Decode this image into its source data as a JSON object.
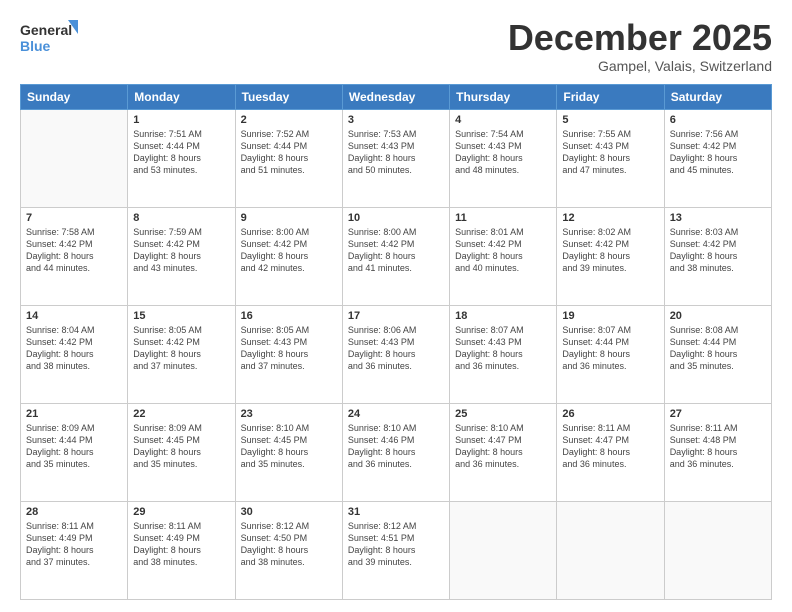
{
  "header": {
    "logo_line1": "General",
    "logo_line2": "Blue",
    "month": "December 2025",
    "location": "Gampel, Valais, Switzerland"
  },
  "weekdays": [
    "Sunday",
    "Monday",
    "Tuesday",
    "Wednesday",
    "Thursday",
    "Friday",
    "Saturday"
  ],
  "weeks": [
    [
      {
        "day": "",
        "detail": ""
      },
      {
        "day": "1",
        "detail": "Sunrise: 7:51 AM\nSunset: 4:44 PM\nDaylight: 8 hours\nand 53 minutes."
      },
      {
        "day": "2",
        "detail": "Sunrise: 7:52 AM\nSunset: 4:44 PM\nDaylight: 8 hours\nand 51 minutes."
      },
      {
        "day": "3",
        "detail": "Sunrise: 7:53 AM\nSunset: 4:43 PM\nDaylight: 8 hours\nand 50 minutes."
      },
      {
        "day": "4",
        "detail": "Sunrise: 7:54 AM\nSunset: 4:43 PM\nDaylight: 8 hours\nand 48 minutes."
      },
      {
        "day": "5",
        "detail": "Sunrise: 7:55 AM\nSunset: 4:43 PM\nDaylight: 8 hours\nand 47 minutes."
      },
      {
        "day": "6",
        "detail": "Sunrise: 7:56 AM\nSunset: 4:42 PM\nDaylight: 8 hours\nand 45 minutes."
      }
    ],
    [
      {
        "day": "7",
        "detail": "Sunrise: 7:58 AM\nSunset: 4:42 PM\nDaylight: 8 hours\nand 44 minutes."
      },
      {
        "day": "8",
        "detail": "Sunrise: 7:59 AM\nSunset: 4:42 PM\nDaylight: 8 hours\nand 43 minutes."
      },
      {
        "day": "9",
        "detail": "Sunrise: 8:00 AM\nSunset: 4:42 PM\nDaylight: 8 hours\nand 42 minutes."
      },
      {
        "day": "10",
        "detail": "Sunrise: 8:00 AM\nSunset: 4:42 PM\nDaylight: 8 hours\nand 41 minutes."
      },
      {
        "day": "11",
        "detail": "Sunrise: 8:01 AM\nSunset: 4:42 PM\nDaylight: 8 hours\nand 40 minutes."
      },
      {
        "day": "12",
        "detail": "Sunrise: 8:02 AM\nSunset: 4:42 PM\nDaylight: 8 hours\nand 39 minutes."
      },
      {
        "day": "13",
        "detail": "Sunrise: 8:03 AM\nSunset: 4:42 PM\nDaylight: 8 hours\nand 38 minutes."
      }
    ],
    [
      {
        "day": "14",
        "detail": "Sunrise: 8:04 AM\nSunset: 4:42 PM\nDaylight: 8 hours\nand 38 minutes."
      },
      {
        "day": "15",
        "detail": "Sunrise: 8:05 AM\nSunset: 4:42 PM\nDaylight: 8 hours\nand 37 minutes."
      },
      {
        "day": "16",
        "detail": "Sunrise: 8:05 AM\nSunset: 4:43 PM\nDaylight: 8 hours\nand 37 minutes."
      },
      {
        "day": "17",
        "detail": "Sunrise: 8:06 AM\nSunset: 4:43 PM\nDaylight: 8 hours\nand 36 minutes."
      },
      {
        "day": "18",
        "detail": "Sunrise: 8:07 AM\nSunset: 4:43 PM\nDaylight: 8 hours\nand 36 minutes."
      },
      {
        "day": "19",
        "detail": "Sunrise: 8:07 AM\nSunset: 4:44 PM\nDaylight: 8 hours\nand 36 minutes."
      },
      {
        "day": "20",
        "detail": "Sunrise: 8:08 AM\nSunset: 4:44 PM\nDaylight: 8 hours\nand 35 minutes."
      }
    ],
    [
      {
        "day": "21",
        "detail": "Sunrise: 8:09 AM\nSunset: 4:44 PM\nDaylight: 8 hours\nand 35 minutes."
      },
      {
        "day": "22",
        "detail": "Sunrise: 8:09 AM\nSunset: 4:45 PM\nDaylight: 8 hours\nand 35 minutes."
      },
      {
        "day": "23",
        "detail": "Sunrise: 8:10 AM\nSunset: 4:45 PM\nDaylight: 8 hours\nand 35 minutes."
      },
      {
        "day": "24",
        "detail": "Sunrise: 8:10 AM\nSunset: 4:46 PM\nDaylight: 8 hours\nand 36 minutes."
      },
      {
        "day": "25",
        "detail": "Sunrise: 8:10 AM\nSunset: 4:47 PM\nDaylight: 8 hours\nand 36 minutes."
      },
      {
        "day": "26",
        "detail": "Sunrise: 8:11 AM\nSunset: 4:47 PM\nDaylight: 8 hours\nand 36 minutes."
      },
      {
        "day": "27",
        "detail": "Sunrise: 8:11 AM\nSunset: 4:48 PM\nDaylight: 8 hours\nand 36 minutes."
      }
    ],
    [
      {
        "day": "28",
        "detail": "Sunrise: 8:11 AM\nSunset: 4:49 PM\nDaylight: 8 hours\nand 37 minutes."
      },
      {
        "day": "29",
        "detail": "Sunrise: 8:11 AM\nSunset: 4:49 PM\nDaylight: 8 hours\nand 38 minutes."
      },
      {
        "day": "30",
        "detail": "Sunrise: 8:12 AM\nSunset: 4:50 PM\nDaylight: 8 hours\nand 38 minutes."
      },
      {
        "day": "31",
        "detail": "Sunrise: 8:12 AM\nSunset: 4:51 PM\nDaylight: 8 hours\nand 39 minutes."
      },
      {
        "day": "",
        "detail": ""
      },
      {
        "day": "",
        "detail": ""
      },
      {
        "day": "",
        "detail": ""
      }
    ]
  ]
}
